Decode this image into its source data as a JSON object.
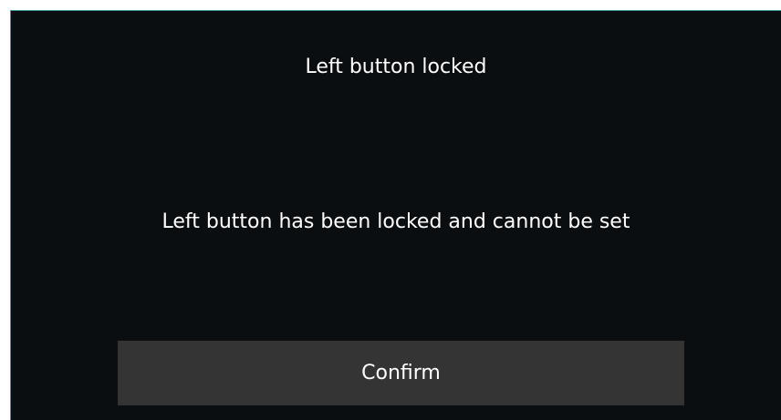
{
  "dialog": {
    "title": "Left button locked",
    "message": "Left button has been locked and cannot be set",
    "confirm_label": "Confirm"
  },
  "colors": {
    "dialog_background": "#0b0e11",
    "button_background": "#343434",
    "text": "#ffffff",
    "accent_border": "#3b9e9a"
  }
}
